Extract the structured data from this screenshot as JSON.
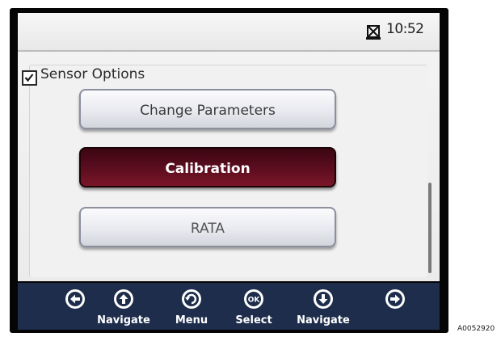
{
  "status": {
    "time": "10:52",
    "icon": "sensor-status-icon"
  },
  "section": {
    "label": "Sensor Options",
    "checked": true
  },
  "menu": {
    "items": [
      {
        "label": "Change Parameters",
        "selected": false
      },
      {
        "label": "Calibration",
        "selected": true
      },
      {
        "label": "RATA",
        "selected": false
      }
    ]
  },
  "footer": {
    "buttons": [
      {
        "icon": "arrow-left-icon",
        "label": ""
      },
      {
        "icon": "arrow-up-icon",
        "label": "Navigate"
      },
      {
        "icon": "undo-icon",
        "label": "Menu"
      },
      {
        "icon": "ok-icon",
        "label": "Select"
      },
      {
        "icon": "arrow-down-icon",
        "label": "Navigate"
      },
      {
        "icon": "arrow-right-icon",
        "label": ""
      }
    ]
  },
  "figure_code": "A0052920",
  "colors": {
    "bezel": "#050505",
    "selected_button": "#5a0d1e",
    "footer": "#1d2d4b"
  }
}
